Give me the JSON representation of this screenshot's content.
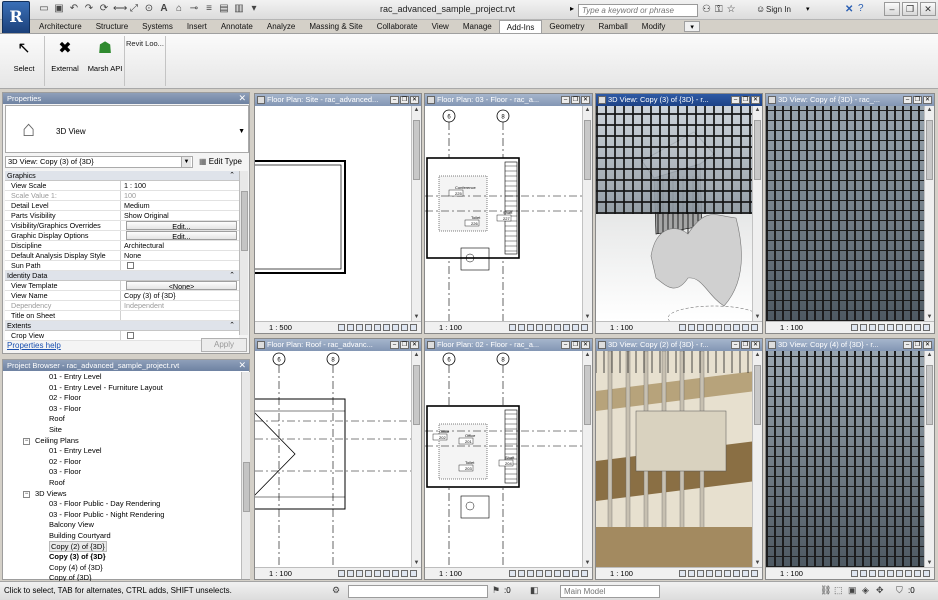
{
  "app": {
    "title": "rac_advanced_sample_project.rvt",
    "logo": "R",
    "search_placeholder": "Type a keyword or phrase",
    "sign_in": "Sign In"
  },
  "tabs": [
    "Architecture",
    "Structure",
    "Systems",
    "Insert",
    "Annotate",
    "Analyze",
    "Massing & Site",
    "Collaborate",
    "View",
    "Manage",
    "Add-Ins",
    "Geometry",
    "Ramball",
    "Modify"
  ],
  "active_tab": "Add-Ins",
  "ribbon": {
    "buttons": [
      {
        "label": "Select",
        "icon": "select-arrow-icon"
      },
      {
        "label": "External",
        "icon": "wrench-icon"
      },
      {
        "label": "Marsh API",
        "icon": "robot-icon"
      }
    ],
    "revit_lookup": "Revit Loo..."
  },
  "properties": {
    "header": "Properties",
    "type_name": "3D View",
    "instance": "3D View: Copy (3) of {3D}",
    "edit_type": "Edit Type",
    "groups": [
      {
        "name": "Graphics",
        "rows": [
          {
            "k": "View Scale",
            "v": "1 : 100"
          },
          {
            "k": "Scale Value    1:",
            "v": "100",
            "dim": true
          },
          {
            "k": "Detail Level",
            "v": "Medium"
          },
          {
            "k": "Parts Visibility",
            "v": "Show Original"
          },
          {
            "k": "Visibility/Graphics Overrides",
            "v": "Edit...",
            "btn": true
          },
          {
            "k": "Graphic Display Options",
            "v": "Edit...",
            "btn": true
          },
          {
            "k": "Discipline",
            "v": "Architectural"
          },
          {
            "k": "Default Analysis Display Style",
            "v": "None"
          },
          {
            "k": "Sun Path",
            "v": "",
            "chk": true
          }
        ]
      },
      {
        "name": "Identity Data",
        "rows": [
          {
            "k": "View Template",
            "v": "<None>",
            "btn": true
          },
          {
            "k": "View Name",
            "v": "Copy (3) of {3D}"
          },
          {
            "k": "Dependency",
            "v": "Independent",
            "dim": true
          },
          {
            "k": "Title on Sheet",
            "v": ""
          }
        ]
      },
      {
        "name": "Extents",
        "rows": [
          {
            "k": "Crop View",
            "v": "",
            "chk": true
          }
        ]
      }
    ],
    "help_link": "Properties help",
    "apply": "Apply"
  },
  "browser": {
    "header": "Project Browser - rac_advanced_sample_project.rvt",
    "items": [
      {
        "label": "01 - Entry Level",
        "level": 3
      },
      {
        "label": "01 - Entry Level - Furniture Layout",
        "level": 3
      },
      {
        "label": "02 - Floor",
        "level": 3
      },
      {
        "label": "03 - Floor",
        "level": 3
      },
      {
        "label": "Roof",
        "level": 3
      },
      {
        "label": "Site",
        "level": 3
      },
      {
        "label": "Ceiling Plans",
        "level": 2,
        "exp": "-"
      },
      {
        "label": "01 - Entry Level",
        "level": 3
      },
      {
        "label": "02 - Floor",
        "level": 3
      },
      {
        "label": "03 - Floor",
        "level": 3
      },
      {
        "label": "Roof",
        "level": 3
      },
      {
        "label": "3D Views",
        "level": 2,
        "exp": "-"
      },
      {
        "label": "03 - Floor Public - Day Rendering",
        "level": 3
      },
      {
        "label": "03 - Floor Public - Night Rendering",
        "level": 3
      },
      {
        "label": "Balcony View",
        "level": 3
      },
      {
        "label": "Building Courtyard",
        "level": 3
      },
      {
        "label": "Copy (2) of {3D}",
        "level": 3,
        "sel": true
      },
      {
        "label": "Copy (3) of {3D}",
        "level": 3,
        "bold": true
      },
      {
        "label": "Copy (4) of {3D}",
        "level": 3
      },
      {
        "label": "Copy of {3D}",
        "level": 3
      }
    ]
  },
  "views": [
    {
      "title": "Floor Plan: Site - rac_advanced...",
      "scale": "1 : 500",
      "kind": "site"
    },
    {
      "title": "Floor Plan: 03 - Floor - rac_a...",
      "scale": "1 : 100",
      "kind": "plan",
      "rooms": [
        "Conference",
        "225",
        "Toilet",
        "226",
        "Shaft",
        "227"
      ]
    },
    {
      "title": "3D View: Copy (3) of {3D} - r...",
      "scale": "1 : 100",
      "kind": "3d-shade",
      "active": true
    },
    {
      "title": "3D View: Copy of {3D} - rac_...",
      "scale": "1 : 100",
      "kind": "3d-real"
    },
    {
      "title": "Floor Plan: Roof - rac_advanc...",
      "scale": "1 : 100",
      "kind": "roof"
    },
    {
      "title": "Floor Plan: 02 - Floor - rac_a...",
      "scale": "1 : 100",
      "kind": "plan2",
      "rooms": [
        "Office",
        "202",
        "Office",
        "201",
        "Toilet",
        "203",
        "Shaft",
        "204"
      ]
    },
    {
      "title": "3D View: Copy (2) of {3D} - r...",
      "scale": "1 : 100",
      "kind": "3d-section"
    },
    {
      "title": "3D View: Copy (4) of {3D} - r...",
      "scale": "1 : 100",
      "kind": "3d-real2"
    }
  ],
  "grid_bubbles": [
    "6",
    "8"
  ],
  "status": {
    "text": "Click to select, TAB for alternates, CTRL adds, SHIFT unselects.",
    "count": ":0",
    "model": "Main Model",
    "filter": ":0"
  }
}
